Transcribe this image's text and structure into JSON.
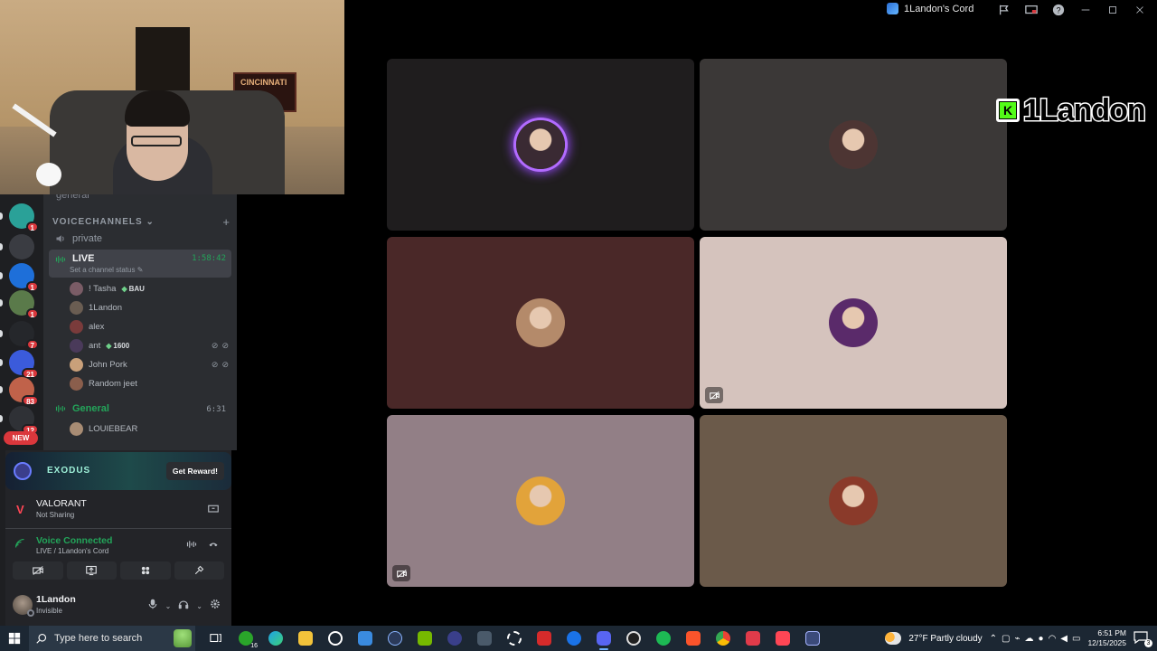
{
  "window": {
    "title": "1Landon's Cord"
  },
  "streamer_tag": {
    "name": "1Landon",
    "platform_letter": "K"
  },
  "webcam": {
    "banner_text": "CINCINNATI"
  },
  "rail": {
    "servers": [
      {
        "badge": "1",
        "color": "#2aa198"
      },
      {
        "badge": "",
        "color": "#3a3c42"
      },
      {
        "badge": "1",
        "color": "#1e6fd9"
      },
      {
        "badge": "1",
        "color": "#5a7a4a"
      },
      {
        "badge": "7",
        "color": "#25272b"
      },
      {
        "badge": "21",
        "color": "#3b5bdb"
      },
      {
        "badge": "83",
        "color": "#c0624a"
      },
      {
        "badge": "12",
        "color": "#2f3136"
      }
    ],
    "new_label": "NEW"
  },
  "channels": {
    "prev_channel": "general",
    "category": "VOICECHANNELS",
    "private": "private",
    "live": {
      "name": "LIVE",
      "time": "1:58:42",
      "status": "Set a channel status"
    },
    "members": [
      {
        "name": "! Tasha",
        "tag": "BAU",
        "color": "#7a5c66",
        "icons": false
      },
      {
        "name": "1Landon",
        "tag": "",
        "color": "#6a5d52",
        "icons": false
      },
      {
        "name": "alex",
        "tag": "",
        "color": "#7a3b3b",
        "icons": false
      },
      {
        "name": "ant",
        "tag": "1600",
        "color": "#4a3a5a",
        "icons": true
      },
      {
        "name": "John Pork",
        "tag": "",
        "color": "#c9a07a",
        "icons": true
      },
      {
        "name": "Random jeet",
        "tag": "",
        "color": "#8a5e4c",
        "icons": false
      }
    ],
    "general": {
      "name": "General",
      "time": "6:31"
    },
    "general_members": [
      {
        "name": "LOUIEBEAR",
        "color": "#a88c74"
      }
    ]
  },
  "panel": {
    "promo": {
      "name": "EXODUS",
      "button": "Get Reward!"
    },
    "activity": {
      "title": "VALORANT",
      "subtitle": "Not Sharing"
    },
    "voice": {
      "title": "Voice Connected",
      "subtitle": "LIVE / 1Landon's Cord"
    },
    "user": {
      "name": "1Landon",
      "status": "Invisible"
    }
  },
  "tiles": [
    {
      "bg": "#1f1d1e",
      "avatar": "#3a2a33",
      "speaking": true,
      "muted": false
    },
    {
      "bg": "#3b3837",
      "avatar": "#4d3533",
      "speaking": false,
      "muted": false
    },
    {
      "bg": "#4a2828",
      "avatar": "#b48a6a",
      "speaking": false,
      "muted": false
    },
    {
      "bg": "#d5c3bd",
      "avatar": "#5a2a6a",
      "speaking": false,
      "muted": true
    },
    {
      "bg": "#927f86",
      "avatar": "#e2a33a",
      "speaking": false,
      "muted": true
    },
    {
      "bg": "#6b5a4a",
      "avatar": "#8a3a2a",
      "speaking": false,
      "muted": false
    }
  ],
  "taskbar": {
    "search_placeholder": "Type here to search",
    "xbox_badge": "16",
    "weather": "27°F  Partly cloudy",
    "time": "6:51 PM",
    "date": "12/15/2025",
    "notif_count": "3"
  }
}
